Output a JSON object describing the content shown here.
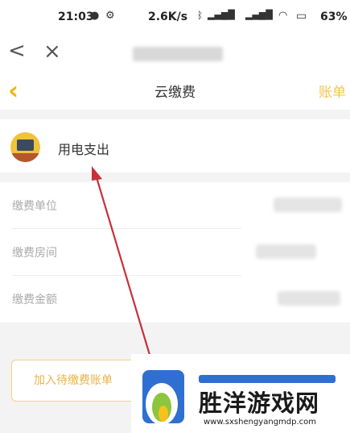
{
  "status_bar": {
    "time": "21:03",
    "network_speed": "2.6K/s",
    "battery": "63%",
    "icons": [
      "wechat-icon",
      "settings-gear-icon",
      "bluetooth-icon",
      "hd-icon",
      "5g-signal-icon",
      "4g-signal-icon",
      "wifi-icon",
      "battery-charging-icon"
    ]
  },
  "browser_bar": {
    "back_icon": "chevron-left-icon",
    "close_icon": "close-icon"
  },
  "app_bar": {
    "back_icon": "chevron-left-icon",
    "title": "云缴费",
    "bill_label": "账单",
    "accent_color": "#f0b619"
  },
  "category": {
    "icon": "laptop-icon",
    "label": "用电支出"
  },
  "form": {
    "rows": [
      {
        "label": "缴费单位"
      },
      {
        "label": "缴费房间"
      },
      {
        "label": "缴费金额"
      }
    ]
  },
  "actions": {
    "add_pending_label": "加入待缴费账单"
  },
  "watermark": {
    "title": "胜洋游戏网",
    "url": "www.sxshengyangmdp.com"
  }
}
